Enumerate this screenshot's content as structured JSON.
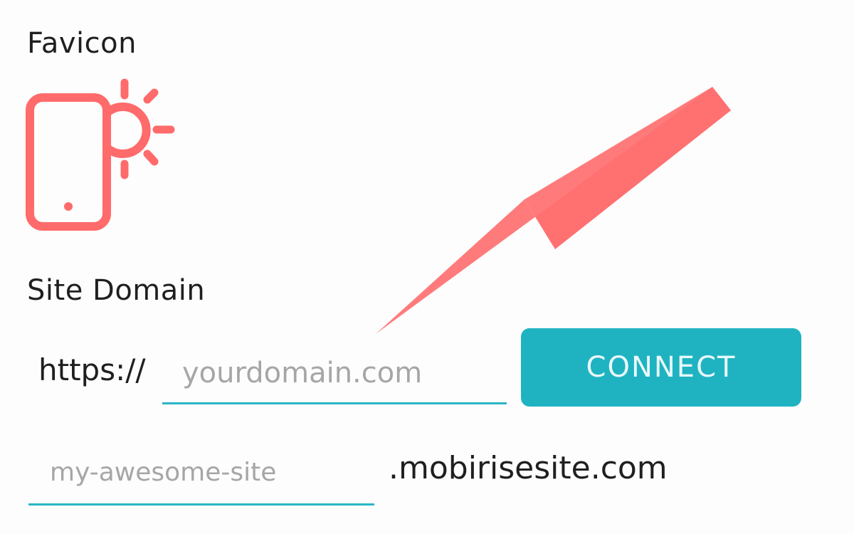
{
  "favicon": {
    "label": "Favicon",
    "icon": "mobile-light-icon",
    "icon_color": "#ff6b6b"
  },
  "site_domain": {
    "label": "Site Domain",
    "protocol": "https://",
    "domain_placeholder": "yourdomain.com",
    "connect_label": "CONNECT",
    "subdomain_placeholder": "my-awesome-site",
    "suffix": ".mobirisesite.com"
  },
  "colors": {
    "accent": "#1fb3c2",
    "arrow": "#ff6f6f"
  }
}
